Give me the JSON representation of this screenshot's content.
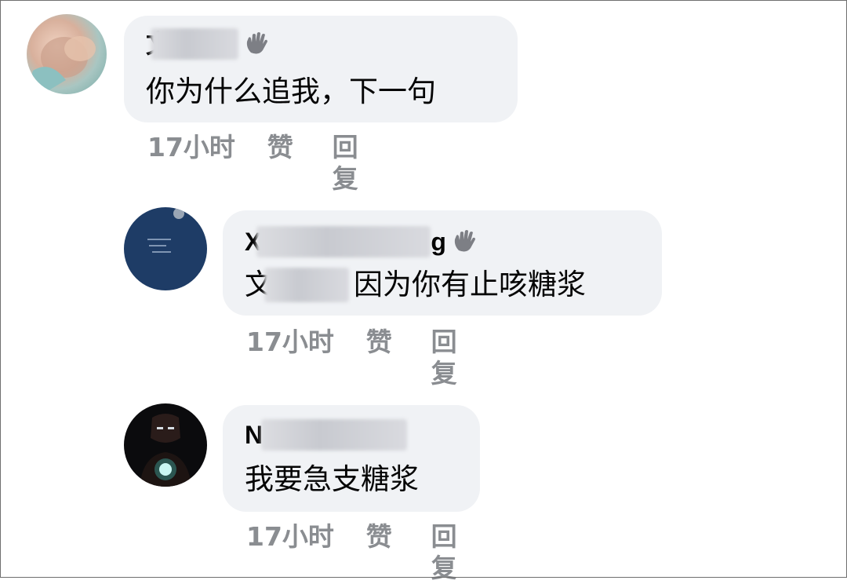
{
  "comments": [
    {
      "name_visible": "文",
      "text": "你为什么追我，下一句",
      "time": "17小时",
      "like_label": "赞",
      "reply_label": "回复"
    },
    {
      "name_visible_start": "X",
      "name_visible_end": "g",
      "mention_visible": "文",
      "text": "因为你有止咳糖浆",
      "time": "17小时",
      "like_label": "赞",
      "reply_label": "回复"
    },
    {
      "name_visible": "N",
      "text": "我要急支糖浆",
      "time": "17小时",
      "like_label": "赞",
      "reply_label": "回复"
    }
  ],
  "colors": {
    "bubble": "#f0f2f5",
    "meta_text": "#8a8d91",
    "name_text": "#050505"
  }
}
